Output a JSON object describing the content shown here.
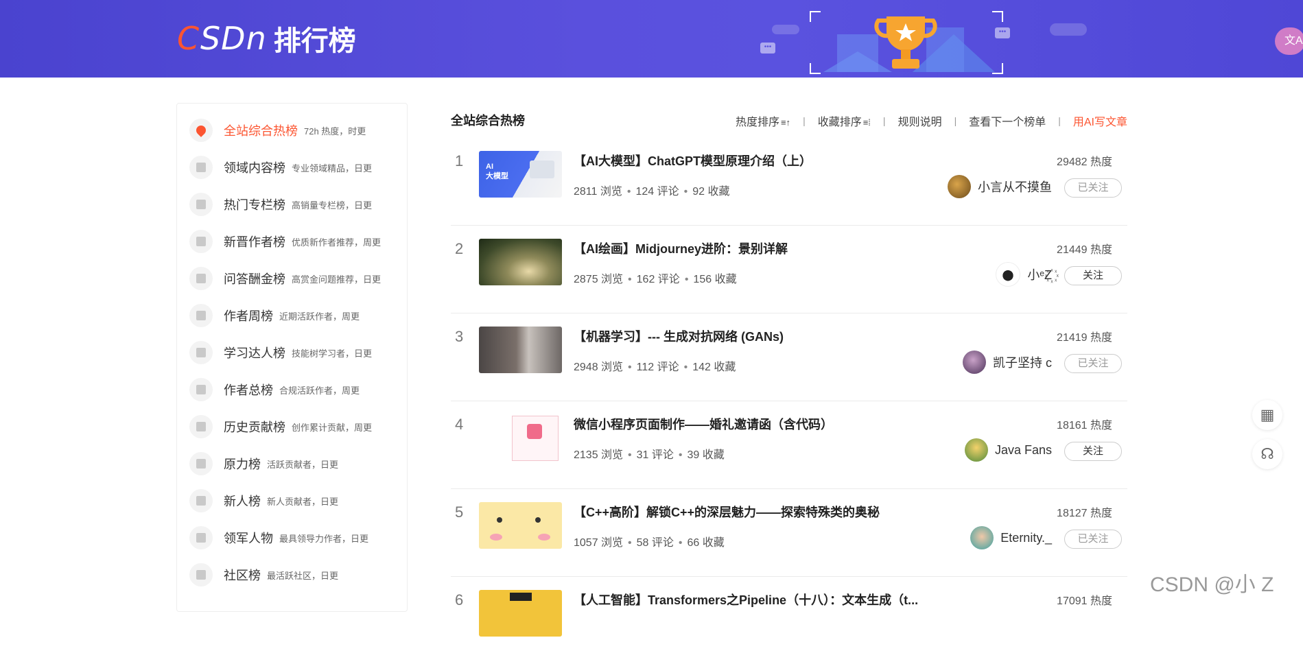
{
  "banner": {
    "logo_text_prefix": "C",
    "logo_text_rest": "SDn",
    "logo_title": "排行榜",
    "translate_label": "文A"
  },
  "sidebar": {
    "items": [
      {
        "label": "全站综合热榜",
        "sub": "72h 热度，时更",
        "active": true
      },
      {
        "label": "领域内容榜",
        "sub": "专业领域精品，日更"
      },
      {
        "label": "热门专栏榜",
        "sub": "高销量专栏榜，日更"
      },
      {
        "label": "新晋作者榜",
        "sub": "优质新作者推荐，周更"
      },
      {
        "label": "问答酬金榜",
        "sub": "高赏金问题推荐，日更"
      },
      {
        "label": "作者周榜",
        "sub": "近期活跃作者，周更"
      },
      {
        "label": "学习达人榜",
        "sub": "技能树学习者，日更"
      },
      {
        "label": "作者总榜",
        "sub": "合规活跃作者，周更"
      },
      {
        "label": "历史贡献榜",
        "sub": "创作累计贡献，周更"
      },
      {
        "label": "原力榜",
        "sub": "活跃贡献者，日更"
      },
      {
        "label": "新人榜",
        "sub": "新人贡献者，日更"
      },
      {
        "label": "领军人物",
        "sub": "最具领导力作者，日更"
      },
      {
        "label": "社区榜",
        "sub": "最活跃社区，日更"
      }
    ]
  },
  "main": {
    "title": "全站综合热榜",
    "actions": {
      "heat_sort": "热度排序",
      "heat_sort_icon": "≡↑",
      "fav_sort": "收藏排序",
      "fav_sort_icon": "≡⁞",
      "rules": "规则说明",
      "next_list": "查看下一个榜单",
      "ai_write": "用AI写文章",
      "sep": "|"
    },
    "stat_labels": {
      "views": "浏览",
      "comments": "评论",
      "favs": "收藏"
    },
    "articles": [
      {
        "rank": "1",
        "title": "【AI大模型】ChatGPT模型原理介绍（上）",
        "views": "2811 浏览",
        "comments": "124 评论",
        "favs": "92 收藏",
        "heat": "29482 热度",
        "author": "小言从不摸鱼",
        "follow": "已关注",
        "followed": true,
        "thumb_text": "AI\n大模型"
      },
      {
        "rank": "2",
        "title": "【AI绘画】Midjourney进阶：景别详解",
        "views": "2875 浏览",
        "comments": "162 评论",
        "favs": "156 收藏",
        "heat": "21449 热度",
        "author": "小ᵉZ꙰",
        "follow": "关注",
        "followed": false
      },
      {
        "rank": "3",
        "title": "【机器学习】--- 生成对抗网络 (GANs)",
        "views": "2948 浏览",
        "comments": "112 评论",
        "favs": "142 收藏",
        "heat": "21419 热度",
        "author": "凯子坚持 c",
        "follow": "已关注",
        "followed": true
      },
      {
        "rank": "4",
        "title": "微信小程序页面制作——婚礼邀请函（含代码）",
        "views": "2135 浏览",
        "comments": "31 评论",
        "favs": "39 收藏",
        "heat": "18161 热度",
        "author": "Java Fans",
        "follow": "关注",
        "followed": false
      },
      {
        "rank": "5",
        "title": "【C++高阶】解锁C++的深层魅力——探索特殊类的奥秘",
        "views": "1057 浏览",
        "comments": "58 评论",
        "favs": "66 收藏",
        "heat": "18127 热度",
        "author": "Eternity._",
        "follow": "已关注",
        "followed": true
      },
      {
        "rank": "6",
        "title": "【人工智能】Transformers之Pipeline（十八）：文本生成（t...",
        "heat": "17091 热度"
      }
    ]
  },
  "floating": {
    "qr_icon": "▦",
    "service_icon": "☊"
  },
  "watermark": "CSDN @小 Z",
  "colors": {
    "brand": "#fc5531",
    "banner": "#5a52df"
  }
}
